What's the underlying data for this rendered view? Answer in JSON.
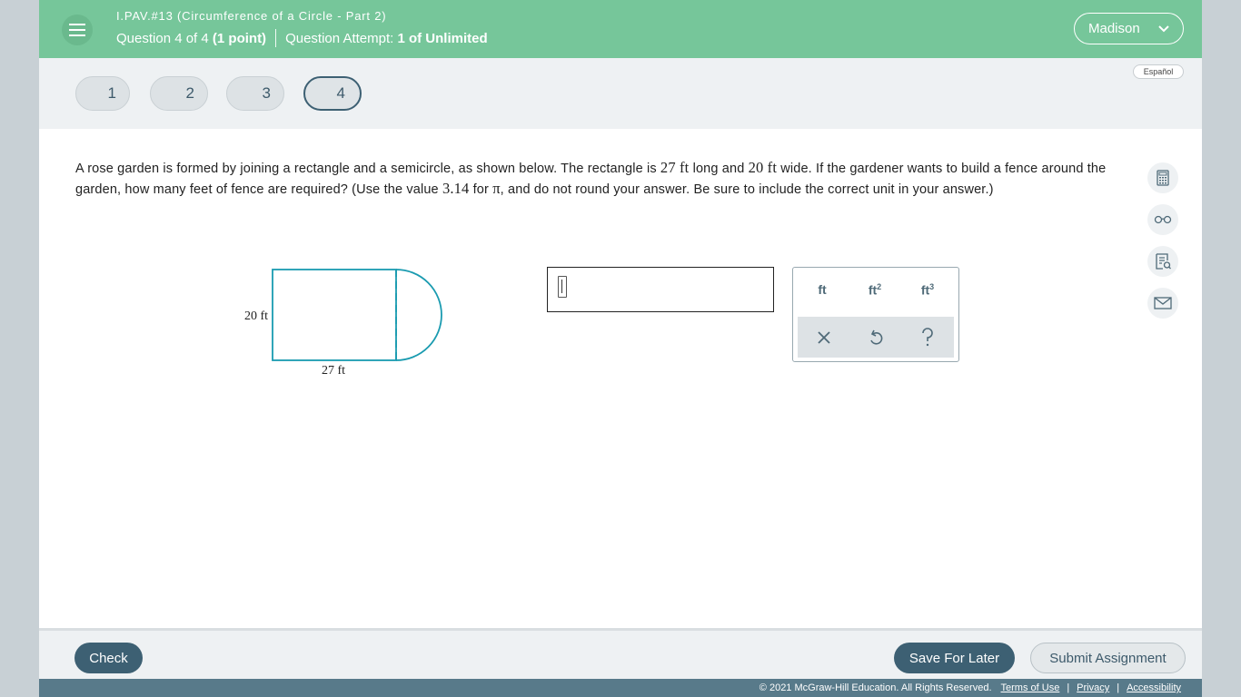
{
  "header": {
    "title": "I.PAV.#13 (Circumference of a Circle - Part 2)",
    "question_label": "Question 4 of 4",
    "points": "(1 point)",
    "attempt_label": "Question Attempt:",
    "attempt_value": "1 of Unlimited",
    "user_name": "Madison",
    "bg_color": "#76c69a"
  },
  "nav": {
    "questions": [
      "1",
      "2",
      "3",
      "4"
    ],
    "active_index": 3,
    "language_button": "Español"
  },
  "question": {
    "p1": "A rose garden is formed by joining a rectangle and a semicircle, as shown below. The rectangle is ",
    "len_value": "27 ft",
    "p2": " long and ",
    "width_value": "20 ft",
    "p3": " wide. If the gardener wants to build a fence around the garden, how many feet of fence are required? (Use the value ",
    "pi_value": "3.14",
    "p4": " for ",
    "pi_symbol": "π",
    "p5": ", and do not round your answer. Be sure to include the correct unit in your answer.)"
  },
  "figure": {
    "width_label": "20 ft",
    "length_label": "27 ft",
    "stroke_color": "#1a9bb0"
  },
  "answer": {
    "value": ""
  },
  "palette": {
    "units": [
      "ft",
      "ft",
      "ft"
    ],
    "unit_powers": [
      "",
      "2",
      "3"
    ],
    "clear_label": "×",
    "undo_label": "↺",
    "help_label": "?"
  },
  "tools": [
    "calculator-icon",
    "glasses-icon",
    "notes-icon",
    "mail-icon"
  ],
  "footer": {
    "check": "Check",
    "save": "Save For Later",
    "submit": "Submit Assignment",
    "copyright": "© 2021 McGraw-Hill Education. All Rights Reserved.",
    "terms": "Terms of Use",
    "privacy": "Privacy",
    "accessibility": "Accessibility"
  }
}
